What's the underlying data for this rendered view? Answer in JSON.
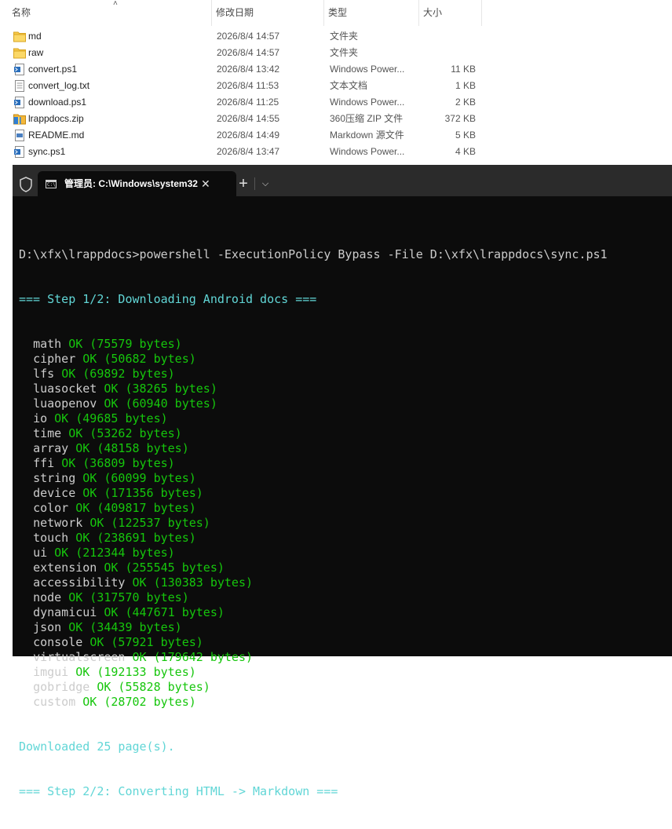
{
  "explorer": {
    "columns": {
      "name": "名称",
      "date": "修改日期",
      "type": "类型",
      "size": "大小"
    },
    "files": [
      {
        "name": "md",
        "date": "2026/8/4 14:57",
        "type": "文件夹",
        "size": "",
        "icon": "folder-icon"
      },
      {
        "name": "raw",
        "date": "2026/8/4 14:57",
        "type": "文件夹",
        "size": "",
        "icon": "folder-icon"
      },
      {
        "name": "convert.ps1",
        "date": "2026/8/4 13:42",
        "type": "Windows Power...",
        "size": "11 KB",
        "icon": "powershell-file-icon"
      },
      {
        "name": "convert_log.txt",
        "date": "2026/8/4 11:53",
        "type": "文本文档",
        "size": "1 KB",
        "icon": "text-file-icon"
      },
      {
        "name": "download.ps1",
        "date": "2026/8/4 11:25",
        "type": "Windows Power...",
        "size": "2 KB",
        "icon": "powershell-file-icon"
      },
      {
        "name": "lrappdocs.zip",
        "date": "2026/8/4 14:55",
        "type": "360压缩 ZIP 文件",
        "size": "372 KB",
        "icon": "zip-file-icon"
      },
      {
        "name": "README.md",
        "date": "2026/8/4 14:49",
        "type": "Markdown 源文件",
        "size": "5 KB",
        "icon": "markdown-file-icon"
      },
      {
        "name": "sync.ps1",
        "date": "2026/8/4 13:47",
        "type": "Windows Power...",
        "size": "4 KB",
        "icon": "powershell-file-icon"
      }
    ]
  },
  "terminal": {
    "tab_title": "管理员: C:\\Windows\\system32",
    "command": "D:\\xfx\\lrappdocs>powershell -ExecutionPolicy Bypass -File D:\\xfx\\lrappdocs\\sync.ps1",
    "step1": "=== Step 1/2: Downloading Android docs ===",
    "entries": [
      {
        "name": "math",
        "status": "OK (75579 bytes)"
      },
      {
        "name": "cipher",
        "status": "OK (50682 bytes)"
      },
      {
        "name": "lfs",
        "status": "OK (69892 bytes)"
      },
      {
        "name": "luasocket",
        "status": "OK (38265 bytes)"
      },
      {
        "name": "luaopenov",
        "status": "OK (60940 bytes)"
      },
      {
        "name": "io",
        "status": "OK (49685 bytes)"
      },
      {
        "name": "time",
        "status": "OK (53262 bytes)"
      },
      {
        "name": "array",
        "status": "OK (48158 bytes)"
      },
      {
        "name": "ffi",
        "status": "OK (36809 bytes)"
      },
      {
        "name": "string",
        "status": "OK (60099 bytes)"
      },
      {
        "name": "device",
        "status": "OK (171356 bytes)"
      },
      {
        "name": "color",
        "status": "OK (409817 bytes)"
      },
      {
        "name": "network",
        "status": "OK (122537 bytes)"
      },
      {
        "name": "touch",
        "status": "OK (238691 bytes)"
      },
      {
        "name": "ui",
        "status": "OK (212344 bytes)"
      },
      {
        "name": "extension",
        "status": "OK (255545 bytes)"
      },
      {
        "name": "accessibility",
        "status": "OK (130383 bytes)"
      },
      {
        "name": "node",
        "status": "OK (317570 bytes)"
      },
      {
        "name": "dynamicui",
        "status": "OK (447671 bytes)"
      },
      {
        "name": "json",
        "status": "OK (34439 bytes)"
      },
      {
        "name": "console",
        "status": "OK (57921 bytes)"
      },
      {
        "name": "virtualscreen",
        "status": "OK (179642 bytes)"
      },
      {
        "name": "imgui",
        "status": "OK (192133 bytes)"
      },
      {
        "name": "gobridge",
        "status": "OK (55828 bytes)"
      },
      {
        "name": "custom",
        "status": "OK (28702 bytes)"
      }
    ],
    "downloaded": "Downloaded 25 page(s).",
    "step2": "=== Step 2/2: Converting HTML -> Markdown ==="
  },
  "colors": {
    "terminal_bg": "#0c0c0c",
    "cyan": "#3a96dd",
    "green": "#16c60c",
    "folder": "#f5c542"
  }
}
